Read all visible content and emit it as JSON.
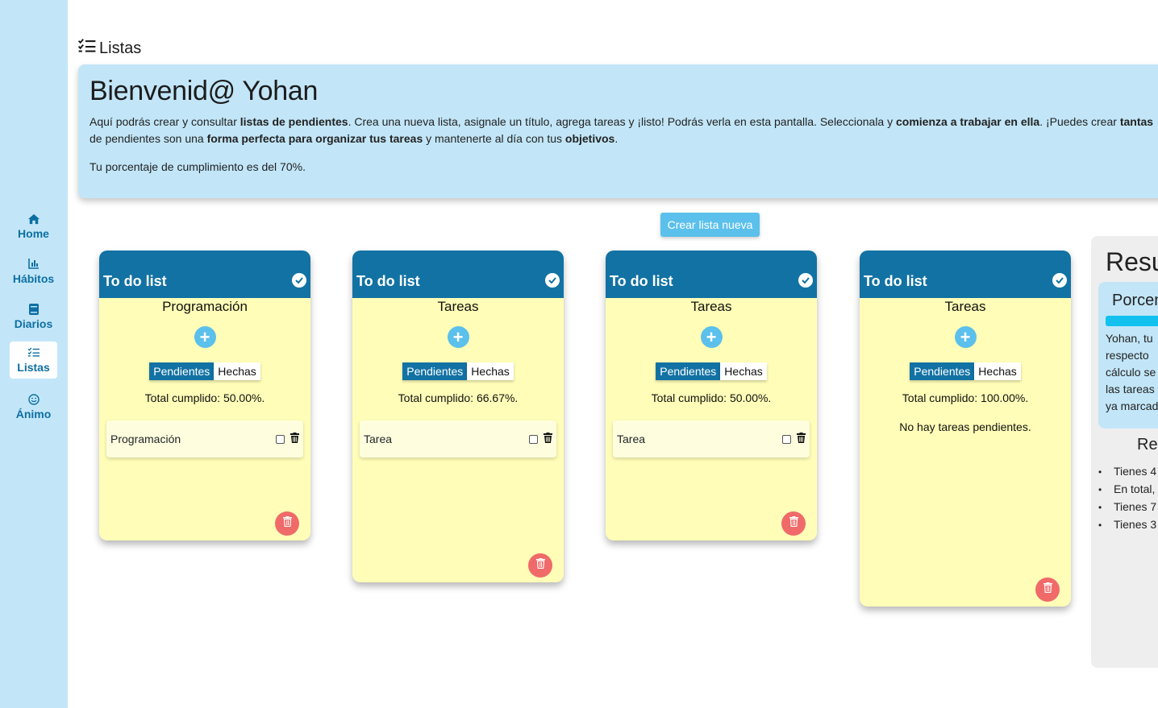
{
  "page": {
    "title": "Listas"
  },
  "nav": {
    "items": [
      {
        "label": "Home",
        "icon": "home-icon"
      },
      {
        "label": "Hábitos",
        "icon": "chart-icon"
      },
      {
        "label": "Diarios",
        "icon": "book-icon"
      },
      {
        "label": "Listas",
        "icon": "list-check-icon",
        "active": true
      },
      {
        "label": "Ánimo",
        "icon": "smile-icon"
      }
    ]
  },
  "banner": {
    "greeting": "Bienvenid@ Yohan",
    "line1": {
      "a": "Aquí podrás crear y consultar ",
      "b": "listas de pendientes",
      "c": ". Crea una nueva lista, asignale un título, agrega tareas y ¡listo! Podrás verla en esta pantalla. Seleccionala y ",
      "d": "comienza a trabajar en ella",
      "e": ". ¡Puedes crear ",
      "f": "tantas"
    },
    "line2": {
      "a": "de pendientes son una ",
      "b": "forma perfecta para organizar tus tareas",
      "c": " y mantenerte al día con tus ",
      "d": "objetivos",
      "e": "."
    },
    "completion": "Tu porcentaje de cumplimiento es del 70%."
  },
  "actions": {
    "create_list": "Crear lista nueva"
  },
  "lists": [
    {
      "header": "To do list",
      "name": "Programación",
      "tab_pending": "Pendientes",
      "tab_done": "Hechas",
      "total": "Total cumplido: 50.00%.",
      "tasks": [
        "Programación"
      ],
      "empty": ""
    },
    {
      "header": "To do list",
      "name": "Tareas",
      "tab_pending": "Pendientes",
      "tab_done": "Hechas",
      "total": "Total cumplido: 66.67%.",
      "tasks": [
        "Tarea"
      ],
      "empty": ""
    },
    {
      "header": "To do list",
      "name": "Tareas",
      "tab_pending": "Pendientes",
      "tab_done": "Hechas",
      "total": "Total cumplido: 50.00%.",
      "tasks": [
        "Tarea"
      ],
      "empty": ""
    },
    {
      "header": "To do list",
      "name": "Tareas",
      "tab_pending": "Pendientes",
      "tab_done": "Hechas",
      "total": "Total cumplido: 100.00%.",
      "tasks": [],
      "empty": "No hay tareas pendientes."
    }
  ],
  "summary": {
    "title": "Resu",
    "percent_title": "Porcen",
    "percent_lines": [
      "Yohan, tu",
      "respecto",
      "cálculo se",
      "las tareas",
      "ya marcad"
    ],
    "progress": 0.7,
    "progress_color": "#12c1ee",
    "r_title": "Re",
    "items": [
      "Tienes 4",
      "En total,",
      "Tienes 7",
      "Tienes 3"
    ]
  },
  "colors": {
    "sidebar": "#c2e6f8",
    "card_header": "#1272a4",
    "card_body": "#fffdb7",
    "accent": "#5bc0eb",
    "danger": "#f06a6a"
  }
}
